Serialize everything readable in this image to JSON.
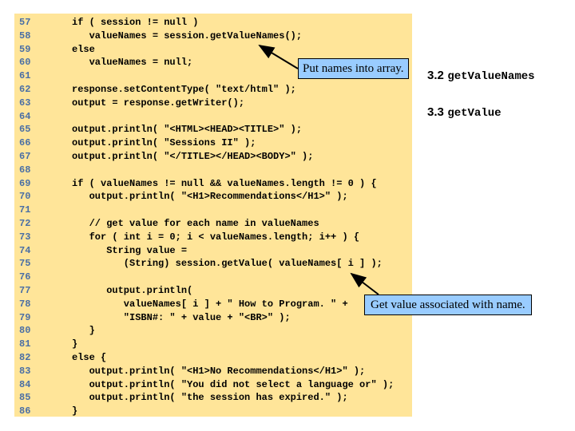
{
  "code_lines": [
    {
      "n": "57",
      "t": "if ( session != null )"
    },
    {
      "n": "58",
      "t": "   valueNames = session.getValueNames();"
    },
    {
      "n": "59",
      "t": "else"
    },
    {
      "n": "60",
      "t": "   valueNames = null;"
    },
    {
      "n": "61",
      "t": ""
    },
    {
      "n": "62",
      "t": "response.setContentType( \"text/html\" );"
    },
    {
      "n": "63",
      "t": "output = response.getWriter();"
    },
    {
      "n": "64",
      "t": ""
    },
    {
      "n": "65",
      "t": "output.println( \"<HTML><HEAD><TITLE>\" );"
    },
    {
      "n": "66",
      "t": "output.println( \"Sessions II\" );"
    },
    {
      "n": "67",
      "t": "output.println( \"</TITLE></HEAD><BODY>\" );"
    },
    {
      "n": "68",
      "t": ""
    },
    {
      "n": "69",
      "t": "if ( valueNames != null && valueNames.length != 0 ) {"
    },
    {
      "n": "70",
      "t": "   output.println( \"<H1>Recommendations</H1>\" );"
    },
    {
      "n": "71",
      "t": ""
    },
    {
      "n": "72",
      "t": "   // get value for each name in valueNames"
    },
    {
      "n": "73",
      "t": "   for ( int i = 0; i < valueNames.length; i++ ) {"
    },
    {
      "n": "74",
      "t": "      String value ="
    },
    {
      "n": "75",
      "t": "         (String) session.getValue( valueNames[ i ] );"
    },
    {
      "n": "76",
      "t": ""
    },
    {
      "n": "77",
      "t": "      output.println("
    },
    {
      "n": "78",
      "t": "         valueNames[ i ] + \" How to Program. \" +"
    },
    {
      "n": "79",
      "t": "         \"ISBN#: \" + value + \"<BR>\" );"
    },
    {
      "n": "80",
      "t": "   }"
    },
    {
      "n": "81",
      "t": "}"
    },
    {
      "n": "82",
      "t": "else {"
    },
    {
      "n": "83",
      "t": "   output.println( \"<H1>No Recommendations</H1>\" );"
    },
    {
      "n": "84",
      "t": "   output.println( \"You did not select a language or\" );"
    },
    {
      "n": "85",
      "t": "   output.println( \"the session has expired.\" );"
    },
    {
      "n": "86",
      "t": "}"
    }
  ],
  "callouts": {
    "names": "Put names into array.",
    "value": "Get value associated with name."
  },
  "notes": [
    {
      "num": "3.2",
      "fn": "getValueNames"
    },
    {
      "num": "3.3",
      "fn": "getValue"
    }
  ],
  "colors": {
    "code_bg": "#ffe599",
    "line_number": "#4a6fa5",
    "callout_bg": "#99ccff"
  }
}
